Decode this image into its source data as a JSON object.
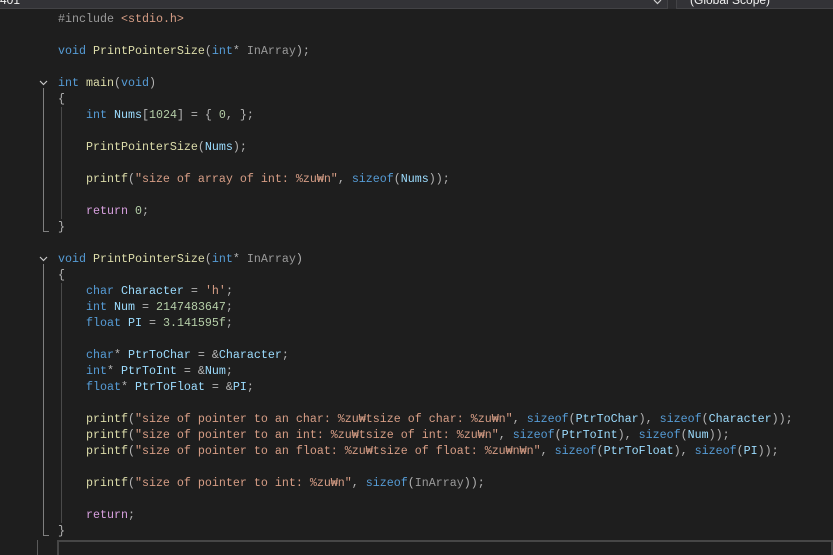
{
  "nav_bar": {
    "project_dropdown": {
      "label": "401"
    },
    "scope_dropdown": {
      "label": "(Global Scope)"
    }
  },
  "editor": {
    "lines": [
      {
        "tokens": [
          [
            "#include ",
            "#9b9b9b"
          ],
          [
            "<stdio.h>",
            "#d69d85"
          ]
        ]
      },
      {
        "tokens": []
      },
      {
        "tokens": [
          [
            "void ",
            "#569cd6"
          ],
          [
            "PrintPointerSize",
            "#dcdcaa"
          ],
          [
            "(",
            "#b4b4b4"
          ],
          [
            "int",
            "#569cd6"
          ],
          [
            "* ",
            "#b4b4b4"
          ],
          [
            "InArray",
            "#9a9a9a"
          ],
          [
            ");",
            "#b4b4b4"
          ]
        ]
      },
      {
        "tokens": []
      },
      {
        "fold": true,
        "tokens": [
          [
            "int ",
            "#569cd6"
          ],
          [
            "main",
            "#dcdcaa"
          ],
          [
            "(",
            "#b4b4b4"
          ],
          [
            "void",
            "#569cd6"
          ],
          [
            ")",
            "#b4b4b4"
          ]
        ]
      },
      {
        "tokens": [
          [
            "{",
            "#b4b4b4"
          ]
        ]
      },
      {
        "tokens": [
          [
            "    int ",
            "#569cd6"
          ],
          [
            "Nums",
            "#9cdcfe"
          ],
          [
            "[",
            "#b4b4b4"
          ],
          [
            "1024",
            "#b5cea8"
          ],
          [
            "] = { ",
            "#b4b4b4"
          ],
          [
            "0",
            "#b5cea8"
          ],
          [
            ", };",
            "#b4b4b4"
          ]
        ]
      },
      {
        "tokens": []
      },
      {
        "tokens": [
          [
            "    PrintPointerSize",
            "#dcdcaa"
          ],
          [
            "(",
            "#b4b4b4"
          ],
          [
            "Nums",
            "#9cdcfe"
          ],
          [
            ");",
            "#b4b4b4"
          ]
        ]
      },
      {
        "tokens": []
      },
      {
        "tokens": [
          [
            "    printf",
            "#dcdcaa"
          ],
          [
            "(",
            "#b4b4b4"
          ],
          [
            "\"size of array of int: %zu₩n\"",
            "#d69d85"
          ],
          [
            ", ",
            "#b4b4b4"
          ],
          [
            "sizeof",
            "#569cd6"
          ],
          [
            "(",
            "#b4b4b4"
          ],
          [
            "Nums",
            "#9cdcfe"
          ],
          [
            "));",
            "#b4b4b4"
          ]
        ]
      },
      {
        "tokens": []
      },
      {
        "tokens": [
          [
            "    return ",
            "#d8a0df"
          ],
          [
            "0",
            "#b5cea8"
          ],
          [
            ";",
            "#b4b4b4"
          ]
        ]
      },
      {
        "fold_end": true,
        "tokens": [
          [
            "}",
            "#b4b4b4"
          ]
        ]
      },
      {
        "tokens": []
      },
      {
        "fold": true,
        "tokens": [
          [
            "void ",
            "#569cd6"
          ],
          [
            "PrintPointerSize",
            "#dcdcaa"
          ],
          [
            "(",
            "#b4b4b4"
          ],
          [
            "int",
            "#569cd6"
          ],
          [
            "* ",
            "#b4b4b4"
          ],
          [
            "InArray",
            "#9a9a9a"
          ],
          [
            ")",
            "#b4b4b4"
          ]
        ]
      },
      {
        "tokens": [
          [
            "{",
            "#b4b4b4"
          ]
        ]
      },
      {
        "tokens": [
          [
            "    char ",
            "#569cd6"
          ],
          [
            "Character",
            "#9cdcfe"
          ],
          [
            " = ",
            "#b4b4b4"
          ],
          [
            "'h'",
            "#d69d85"
          ],
          [
            ";",
            "#b4b4b4"
          ]
        ]
      },
      {
        "tokens": [
          [
            "    int ",
            "#569cd6"
          ],
          [
            "Num",
            "#9cdcfe"
          ],
          [
            " = ",
            "#b4b4b4"
          ],
          [
            "2147483647",
            "#b5cea8"
          ],
          [
            ";",
            "#b4b4b4"
          ]
        ]
      },
      {
        "tokens": [
          [
            "    float ",
            "#569cd6"
          ],
          [
            "PI",
            "#9cdcfe"
          ],
          [
            " = ",
            "#b4b4b4"
          ],
          [
            "3.141595f",
            "#b5cea8"
          ],
          [
            ";",
            "#b4b4b4"
          ]
        ]
      },
      {
        "tokens": []
      },
      {
        "tokens": [
          [
            "    char",
            "#569cd6"
          ],
          [
            "* ",
            "#b4b4b4"
          ],
          [
            "PtrToChar",
            "#9cdcfe"
          ],
          [
            " = &",
            "#b4b4b4"
          ],
          [
            "Character",
            "#9cdcfe"
          ],
          [
            ";",
            "#b4b4b4"
          ]
        ]
      },
      {
        "tokens": [
          [
            "    int",
            "#569cd6"
          ],
          [
            "* ",
            "#b4b4b4"
          ],
          [
            "PtrToInt",
            "#9cdcfe"
          ],
          [
            " = &",
            "#b4b4b4"
          ],
          [
            "Num",
            "#9cdcfe"
          ],
          [
            ";",
            "#b4b4b4"
          ]
        ]
      },
      {
        "tokens": [
          [
            "    float",
            "#569cd6"
          ],
          [
            "* ",
            "#b4b4b4"
          ],
          [
            "PtrToFloat",
            "#9cdcfe"
          ],
          [
            " = &",
            "#b4b4b4"
          ],
          [
            "PI",
            "#9cdcfe"
          ],
          [
            ";",
            "#b4b4b4"
          ]
        ]
      },
      {
        "tokens": []
      },
      {
        "tokens": [
          [
            "    printf",
            "#dcdcaa"
          ],
          [
            "(",
            "#b4b4b4"
          ],
          [
            "\"size of pointer to an char: %zu₩tsize of char: %zu₩n\"",
            "#d69d85"
          ],
          [
            ", ",
            "#b4b4b4"
          ],
          [
            "sizeof",
            "#569cd6"
          ],
          [
            "(",
            "#b4b4b4"
          ],
          [
            "PtrToChar",
            "#9cdcfe"
          ],
          [
            "), ",
            "#b4b4b4"
          ],
          [
            "sizeof",
            "#569cd6"
          ],
          [
            "(",
            "#b4b4b4"
          ],
          [
            "Character",
            "#9cdcfe"
          ],
          [
            "));",
            "#b4b4b4"
          ]
        ]
      },
      {
        "tokens": [
          [
            "    printf",
            "#dcdcaa"
          ],
          [
            "(",
            "#b4b4b4"
          ],
          [
            "\"size of pointer to an int: %zu₩tsize of int: %zu₩n\"",
            "#d69d85"
          ],
          [
            ", ",
            "#b4b4b4"
          ],
          [
            "sizeof",
            "#569cd6"
          ],
          [
            "(",
            "#b4b4b4"
          ],
          [
            "PtrToInt",
            "#9cdcfe"
          ],
          [
            "), ",
            "#b4b4b4"
          ],
          [
            "sizeof",
            "#569cd6"
          ],
          [
            "(",
            "#b4b4b4"
          ],
          [
            "Num",
            "#9cdcfe"
          ],
          [
            "));",
            "#b4b4b4"
          ]
        ]
      },
      {
        "tokens": [
          [
            "    printf",
            "#dcdcaa"
          ],
          [
            "(",
            "#b4b4b4"
          ],
          [
            "\"size of pointer to an float: %zu₩tsize of float: %zu₩n₩n\"",
            "#d69d85"
          ],
          [
            ", ",
            "#b4b4b4"
          ],
          [
            "sizeof",
            "#569cd6"
          ],
          [
            "(",
            "#b4b4b4"
          ],
          [
            "PtrToFloat",
            "#9cdcfe"
          ],
          [
            "), ",
            "#b4b4b4"
          ],
          [
            "sizeof",
            "#569cd6"
          ],
          [
            "(",
            "#b4b4b4"
          ],
          [
            "PI",
            "#9cdcfe"
          ],
          [
            "));",
            "#b4b4b4"
          ]
        ]
      },
      {
        "tokens": []
      },
      {
        "tokens": [
          [
            "    printf",
            "#dcdcaa"
          ],
          [
            "(",
            "#b4b4b4"
          ],
          [
            "\"size of pointer to int: %zu₩n\"",
            "#d69d85"
          ],
          [
            ", ",
            "#b4b4b4"
          ],
          [
            "sizeof",
            "#569cd6"
          ],
          [
            "(",
            "#b4b4b4"
          ],
          [
            "InArray",
            "#9a9a9a"
          ],
          [
            "));",
            "#b4b4b4"
          ]
        ]
      },
      {
        "tokens": []
      },
      {
        "tokens": [
          [
            "    return",
            "#d8a0df"
          ],
          [
            ";",
            "#b4b4b4"
          ]
        ]
      },
      {
        "fold_end": true,
        "tokens": [
          [
            "}",
            "#b4b4b4"
          ]
        ]
      },
      {
        "current": true,
        "tokens": []
      }
    ]
  }
}
